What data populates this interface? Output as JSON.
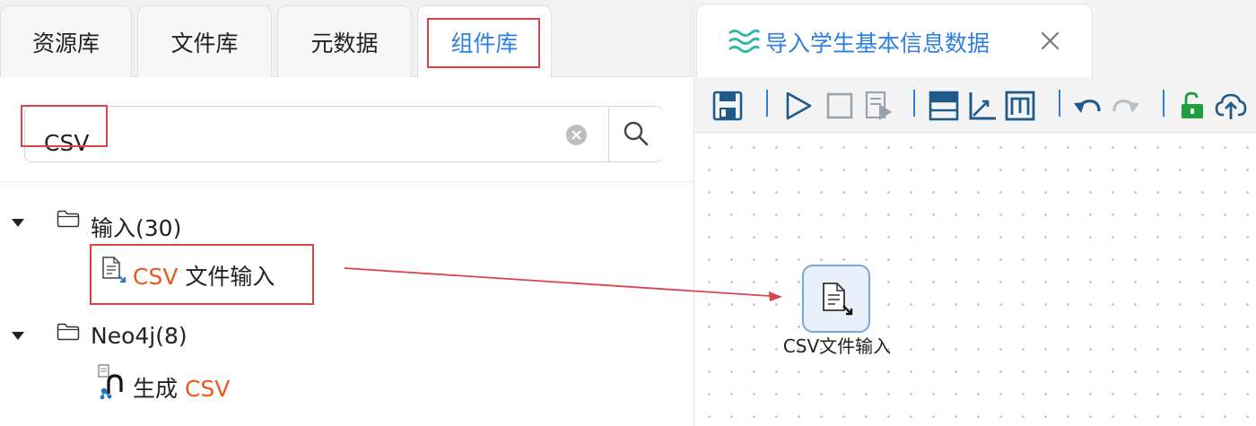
{
  "left_panel": {
    "tabs": [
      {
        "label": "资源库",
        "active": false
      },
      {
        "label": "文件库",
        "active": false
      },
      {
        "label": "元数据",
        "active": false
      },
      {
        "label": "组件库",
        "active": true
      }
    ],
    "search": {
      "value": "CSV",
      "placeholder": ""
    },
    "tree": [
      {
        "group_label": "输入(30)",
        "expanded": true,
        "icon": "folder-icon",
        "items": [
          {
            "highlight": "CSV",
            "rest": " 文件输入",
            "icon": "csv-file-input-icon"
          }
        ]
      },
      {
        "group_label": "Neo4j(8)",
        "expanded": true,
        "icon": "folder-icon",
        "items": [
          {
            "prefix": "生成 ",
            "highlight": "CSV",
            "icon": "neo4j-csv-icon"
          }
        ]
      }
    ]
  },
  "right_panel": {
    "tab": {
      "label": "导入学生基本信息数据",
      "icon": "flow-waves-icon"
    },
    "toolbar": [
      "save-icon",
      "run-icon",
      "stop-icon",
      "step-run-icon",
      "table-icon",
      "axis-icon",
      "metric-icon",
      "undo-icon",
      "redo-icon",
      "unlock-icon",
      "upload-icon"
    ],
    "canvas": {
      "node_label": "CSV文件输入",
      "node_icon": "csv-file-input-icon"
    }
  },
  "colors": {
    "accent": "#2f7fe0",
    "highlight": "#e8591c",
    "annotation": "#d9454a",
    "unlock": "#1e9e3e"
  }
}
